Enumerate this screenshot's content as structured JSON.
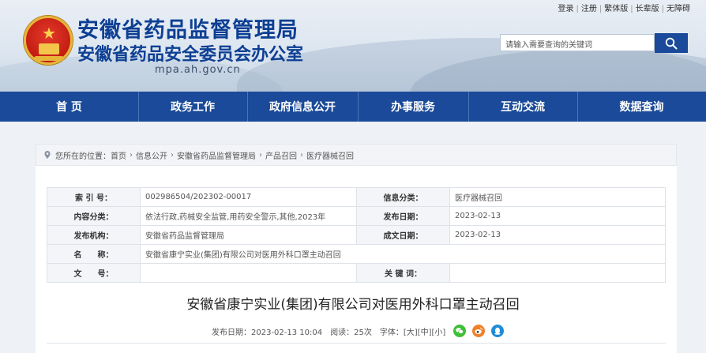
{
  "header": {
    "title_main": "安徽省药品监督管理局",
    "title_sub": "安徽省药品安全委员会办公室",
    "domain": "mpa.ah.gov.cn",
    "top_links": [
      "登录",
      "注册",
      "繁体版",
      "长辈版",
      "无障碍"
    ],
    "search": {
      "placeholder": "请输入需要查询的关键词"
    }
  },
  "nav": {
    "items": [
      "首 页",
      "政务工作",
      "政府信息公开",
      "办事服务",
      "互动交流",
      "数据查询"
    ]
  },
  "breadcrumb": {
    "prefix": "您所在的位置：",
    "items": [
      "首页",
      "信息公开",
      "安徽省药品监督管理局",
      "产品召回",
      "医疗器械召回"
    ]
  },
  "meta_table": {
    "index_label": "索 引 号：",
    "index_value": "002986504/202302-00017",
    "info_class_label": "信息分类：",
    "info_class_value": "医疗器械召回",
    "content_class_label": "内容分类：",
    "content_class_value": "依法行政,药械安全监管,用药安全警示,其他,2023年",
    "publish_date_label": "发布日期：",
    "publish_date_value": "2023-02-13",
    "publisher_label": "发布机构：",
    "publisher_value": "安徽省药品监督管理局",
    "written_date_label": "成文日期：",
    "written_date_value": "2023-02-13",
    "name_label": "名　　称：",
    "name_value": "安徽省康宁实业(集团)有限公司对医用外科口罩主动召回",
    "doc_no_label": "文　　号：",
    "doc_no_value": "",
    "keywords_label": "关 键 词：",
    "keywords_value": ""
  },
  "article": {
    "title": "安徽省康宁实业(集团)有限公司对医用外科口罩主动召回",
    "publish_time": "发布日期：2023-02-13 10:04",
    "views": "阅读：25次",
    "font_label": "字体：",
    "font_large": "[大]",
    "font_medium": "[中]",
    "font_small": "[小]"
  },
  "colors": {
    "brand_blue": "#1a4a99",
    "title_blue": "#0d3f93"
  }
}
